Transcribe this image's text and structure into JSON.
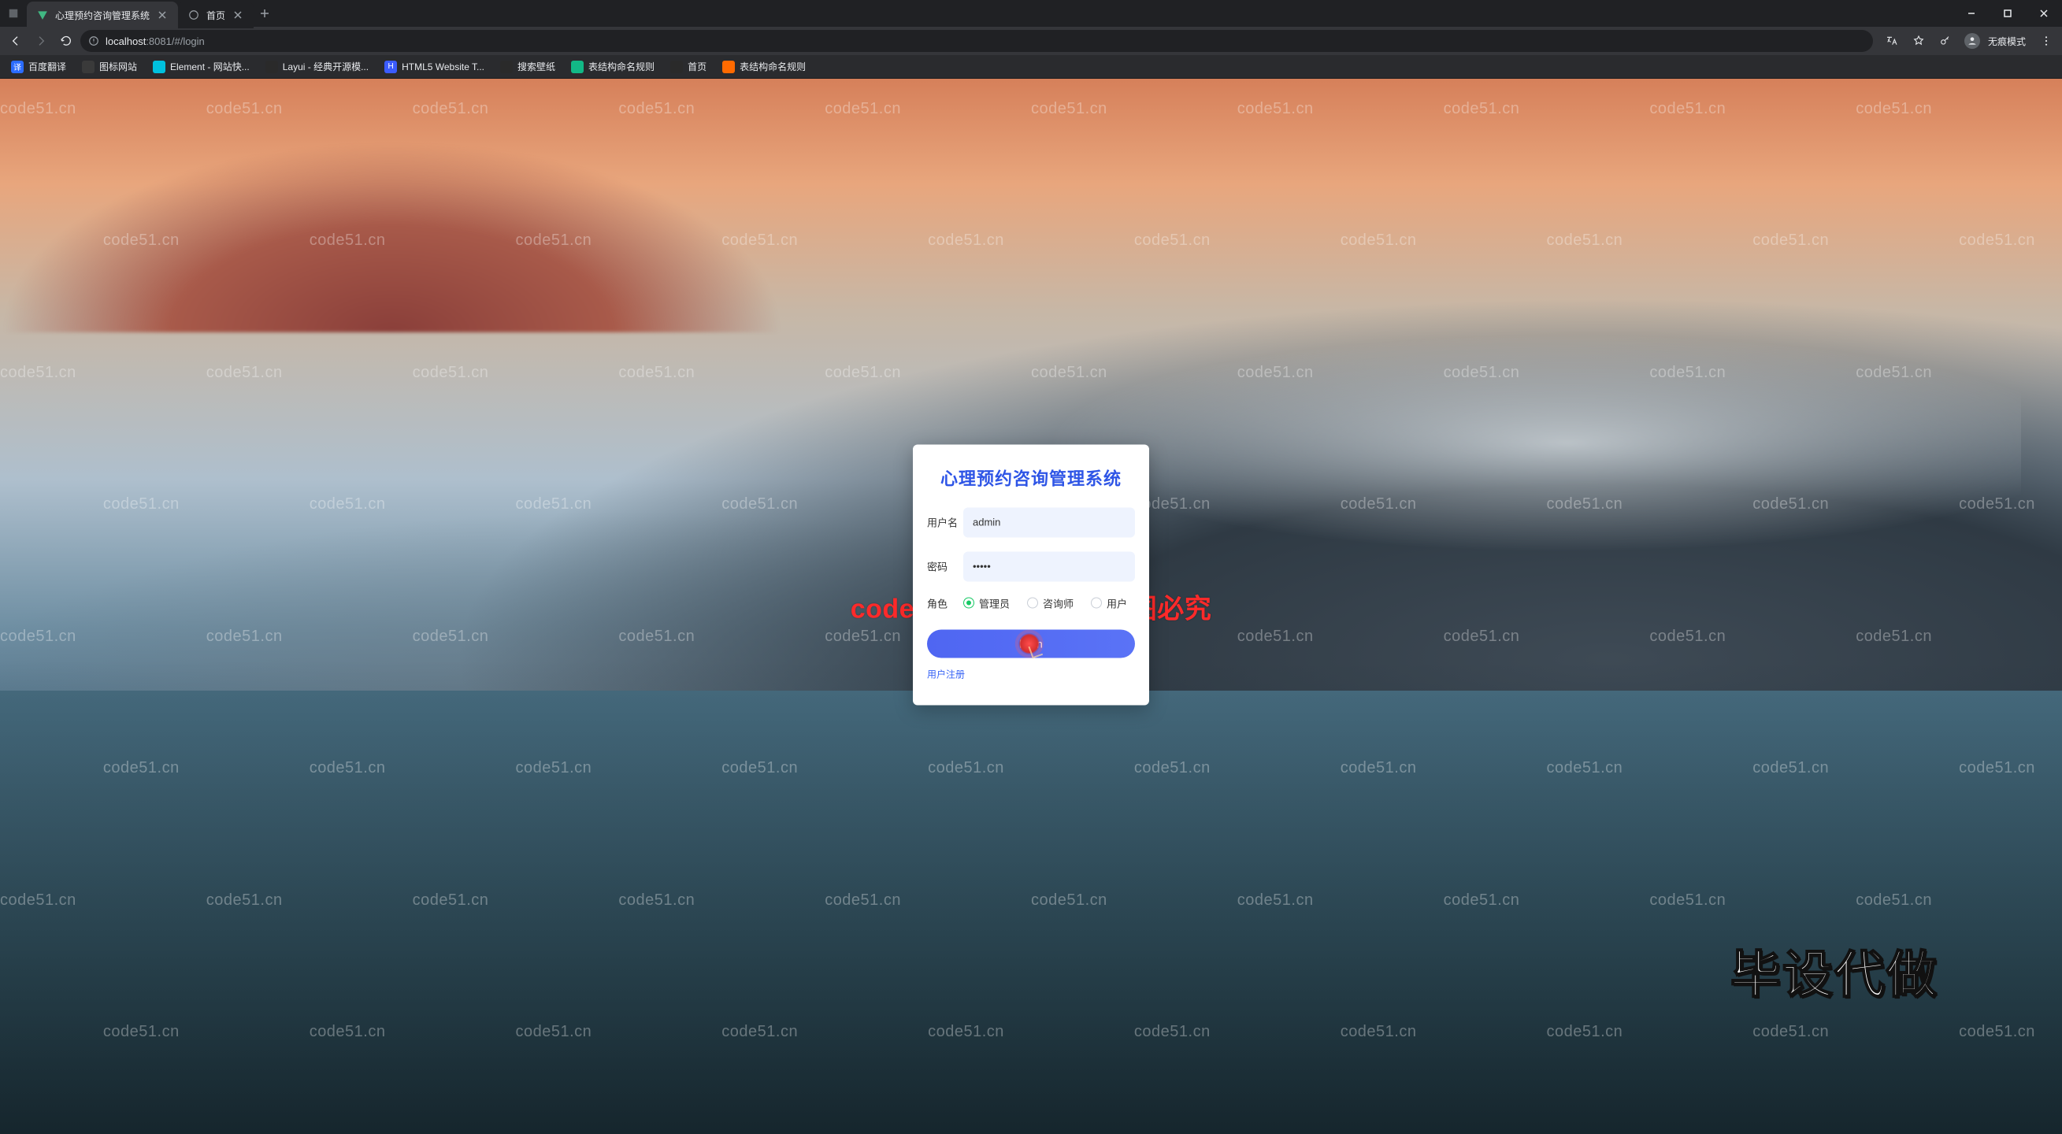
{
  "browser": {
    "tabs": [
      {
        "title": "心理预约咨询管理系统",
        "favicon_color": "#41b883",
        "favicon_letter": "V",
        "active": true
      },
      {
        "title": "首页",
        "favicon_color": "#9aa0a6",
        "favicon_letter": "",
        "active": false
      }
    ],
    "url_host": "localhost",
    "url_port": ":8081",
    "url_path": "/#/login",
    "incognito_label": "无痕模式",
    "bookmarks": [
      {
        "label": "百度翻译",
        "color": "#2b6cff",
        "letter": "译"
      },
      {
        "label": "图标网站",
        "color": "#2a2a2a",
        "letter": ""
      },
      {
        "label": "Element - 网站快...",
        "color": "#00c1de",
        "letter": ""
      },
      {
        "label": "Layui - 经典开源模...",
        "color": "#2a2a2a",
        "letter": ""
      },
      {
        "label": "HTML5 Website T...",
        "color": "#3b5cff",
        "letter": "H"
      },
      {
        "label": "搜索壁纸",
        "color": "#2a2a2a",
        "letter": ""
      },
      {
        "label": "表结构命名规则",
        "color": "#12b886",
        "letter": ""
      },
      {
        "label": "首页",
        "color": "#2a2a2a",
        "letter": ""
      },
      {
        "label": "表结构命名规则",
        "color": "#ff6a00",
        "letter": ""
      }
    ]
  },
  "login": {
    "title": "心理预约咨询管理系统",
    "username_label": "用户名",
    "username_value": "admin",
    "password_label": "密码",
    "password_value": "•••••",
    "role_label": "角色",
    "roles": [
      {
        "label": "管理员",
        "checked": true
      },
      {
        "label": "咨询师",
        "checked": false
      },
      {
        "label": "用户",
        "checked": false
      }
    ],
    "login_button": "login",
    "register_link": "用户注册"
  },
  "watermark": {
    "repeat_text": "code51.cn",
    "center_text": "code51.cn-源码乐园盗图必究",
    "big_text": "毕设代做"
  }
}
